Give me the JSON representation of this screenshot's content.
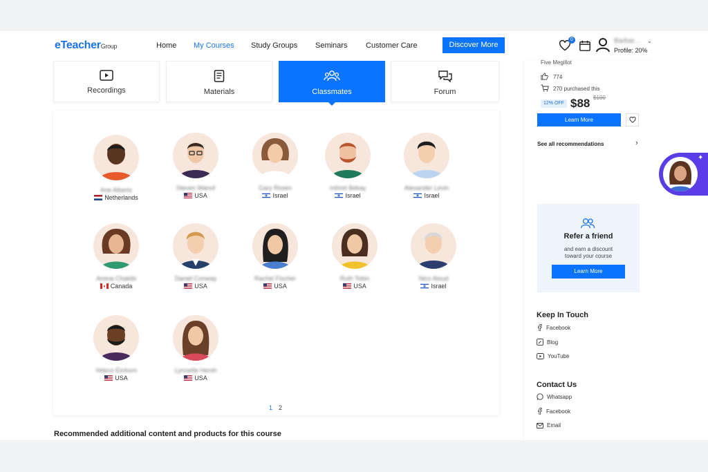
{
  "header": {
    "logo_main": "eTeacher",
    "logo_sub": "Group",
    "nav": [
      "Home",
      "My Courses",
      "Study Groups",
      "Seminars",
      "Customer Care"
    ],
    "discover": "Discover More",
    "wishlist_count": "0",
    "user_name": "Barbar...",
    "profile": "Profile: 20%",
    "accent": "#0a73ff"
  },
  "tabs": [
    "Recordings",
    "Materials",
    "Classmates",
    "Forum"
  ],
  "classmates": [
    {
      "name": "Arie Alberts",
      "country": "Netherlands"
    },
    {
      "name": "Steven Wanof",
      "country": "USA"
    },
    {
      "name": "Gary Rosen",
      "country": "Israel"
    },
    {
      "name": "mihret Bekay",
      "country": "Israel"
    },
    {
      "name": "Alexander Levin",
      "country": "Israel"
    },
    {
      "name": "Amina Chakibi",
      "country": "Canada"
    },
    {
      "name": "Daniel Conway",
      "country": "USA"
    },
    {
      "name": "Rachel Fischer",
      "country": "USA"
    },
    {
      "name": "Ruth Tobin",
      "country": "USA"
    },
    {
      "name": "Nico Aloud",
      "country": "Israel"
    },
    {
      "name": "Yeleno Einhorn",
      "country": "USA"
    },
    {
      "name": "Lynnette Hersh",
      "country": "USA"
    }
  ],
  "pagination": [
    "1",
    "2"
  ],
  "recommended_heading": "Recommended additional content and products for this course",
  "sidebar": {
    "product_name": "Five Megillot",
    "likes": "774",
    "purchased": "270 purchased this",
    "discount": "12% OFF",
    "price": "$88",
    "old_price": "$100",
    "learn_more": "Learn More",
    "see_all": "See all recommendations",
    "refer_title": "Refer a friend",
    "refer_line1": "and earn a discount",
    "refer_line2": "toward your course",
    "refer_button": "Learn More",
    "keep_heading": "Keep In Touch",
    "keep_links": [
      "Facebook",
      "Blog",
      "YouTube"
    ],
    "contact_heading": "Contact Us",
    "contact_links": [
      "Whatsapp",
      "Facebook",
      "Email"
    ]
  }
}
